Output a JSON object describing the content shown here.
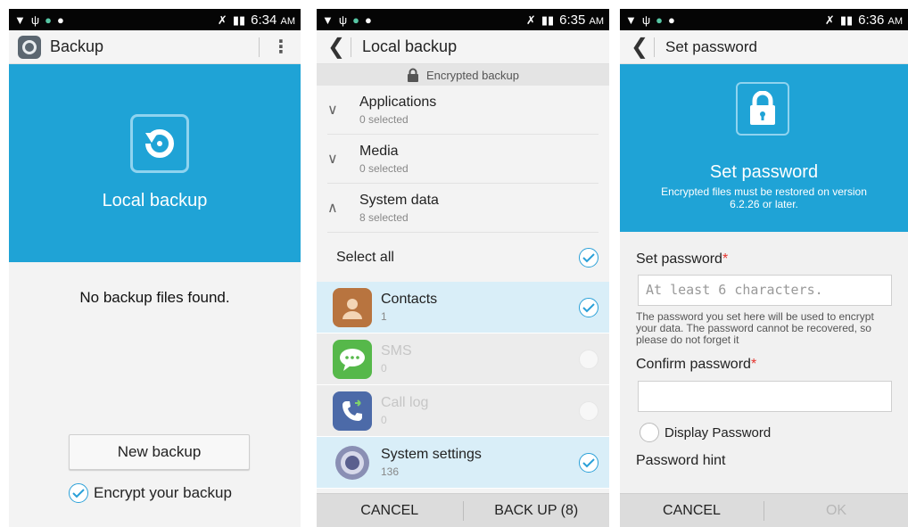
{
  "screen1": {
    "status": {
      "time": "6:34",
      "ampm": "AM"
    },
    "title": "Backup",
    "hero_title": "Local backup",
    "empty_message": "No backup files found.",
    "new_backup_label": "New backup",
    "encrypt_label": "Encrypt your backup"
  },
  "screen2": {
    "status": {
      "time": "6:35",
      "ampm": "AM"
    },
    "title": "Local backup",
    "encrypted_label": "Encrypted backup",
    "categories": [
      {
        "title": "Applications",
        "sub": "0 selected",
        "expanded": false
      },
      {
        "title": "Media",
        "sub": "0 selected",
        "expanded": false
      },
      {
        "title": "System data",
        "sub": "8 selected",
        "expanded": true
      }
    ],
    "select_all_label": "Select all",
    "items": [
      {
        "title": "Contacts",
        "sub": "1",
        "checked": true,
        "icon": "contacts-icon"
      },
      {
        "title": "SMS",
        "sub": "0",
        "checked": false,
        "icon": "sms-icon"
      },
      {
        "title": "Call log",
        "sub": "0",
        "checked": false,
        "icon": "call-log-icon"
      },
      {
        "title": "System settings",
        "sub": "136",
        "checked": true,
        "icon": "settings-icon"
      }
    ],
    "cancel_label": "CANCEL",
    "backup_label": "BACK UP (8)"
  },
  "screen3": {
    "status": {
      "time": "6:36",
      "ampm": "AM"
    },
    "title": "Set password",
    "hero_title": "Set password",
    "hero_sub": "Encrypted files must be restored on version 6.2.26 or later.",
    "password_label": "Set password",
    "password_placeholder": "At least 6 characters.",
    "password_hint": "The password you set here will be used to encrypt your data. The password cannot be recovered, so please do not forget it",
    "confirm_label": "Confirm password",
    "display_password_label": "Display Password",
    "password_hint_label": "Password hint",
    "required_mark": "*",
    "cancel_label": "CANCEL",
    "ok_label": "OK"
  },
  "colors": {
    "accent": "#1fa3d6",
    "check": "#2aa0d8",
    "selected_row": "#d9eef8"
  }
}
